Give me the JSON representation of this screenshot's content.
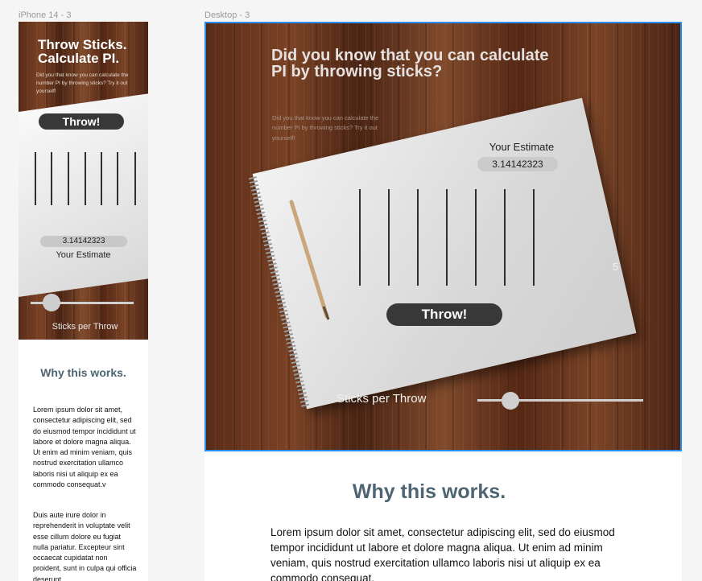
{
  "frames": {
    "phone_label": "iPhone 14 - 3",
    "desktop_label": "Desktop - 3"
  },
  "phone": {
    "title": "Throw Sticks. Calculate PI.",
    "subtitle": "Did you that know you can calculate the number PI by throwing sticks? Try it out yourself!",
    "throw_label": "Throw!",
    "estimate_value": "3.14142323",
    "estimate_label": "Your Estimate",
    "slider_label": "Sticks per Throw",
    "slider_fraction": 0.2,
    "why_title": "Why this works.",
    "para1": "Lorem ipsum dolor sit amet, consectetur adipiscing elit, sed do eiusmod tempor incididunt ut labore et dolore magna aliqua. Ut enim ad minim veniam, quis nostrud exercitation ullamco laboris nisi ut aliquip ex ea commodo consequat.v",
    "para2": "Duis aute irure dolor in reprehenderit in voluptate velit esse cillum dolore eu fugiat nulla pariatur. Excepteur sint occaecat cupidatat non proident, sunt in culpa qui officia deserunt"
  },
  "desktop": {
    "title": "Did you know that you can calculate PI by throwing sticks?",
    "subtitle": "Did you that know you can calculate the number PI by throwing sticks? Try it out yourself!",
    "estimate_label": "Your Estimate",
    "estimate_value": "3.14142323",
    "throw_label": "Throw!",
    "sticks_count": "5",
    "slider_label": "Sticks per Throw",
    "slider_fraction": 0.2,
    "why_title": "Why this works.",
    "para1": "Lorem ipsum dolor sit amet, consectetur adipiscing elit, sed do eiusmod tempor incididunt ut labore et dolore magna aliqua. Ut enim ad minim veniam, quis nostrud exercitation ullamco laboris nisi ut aliquip ex ea commodo consequat."
  },
  "colors": {
    "selection": "#2a8df0",
    "heading": "#4d6573",
    "button": "#383838"
  },
  "icons": {
    "pencil": "pencil-icon"
  }
}
